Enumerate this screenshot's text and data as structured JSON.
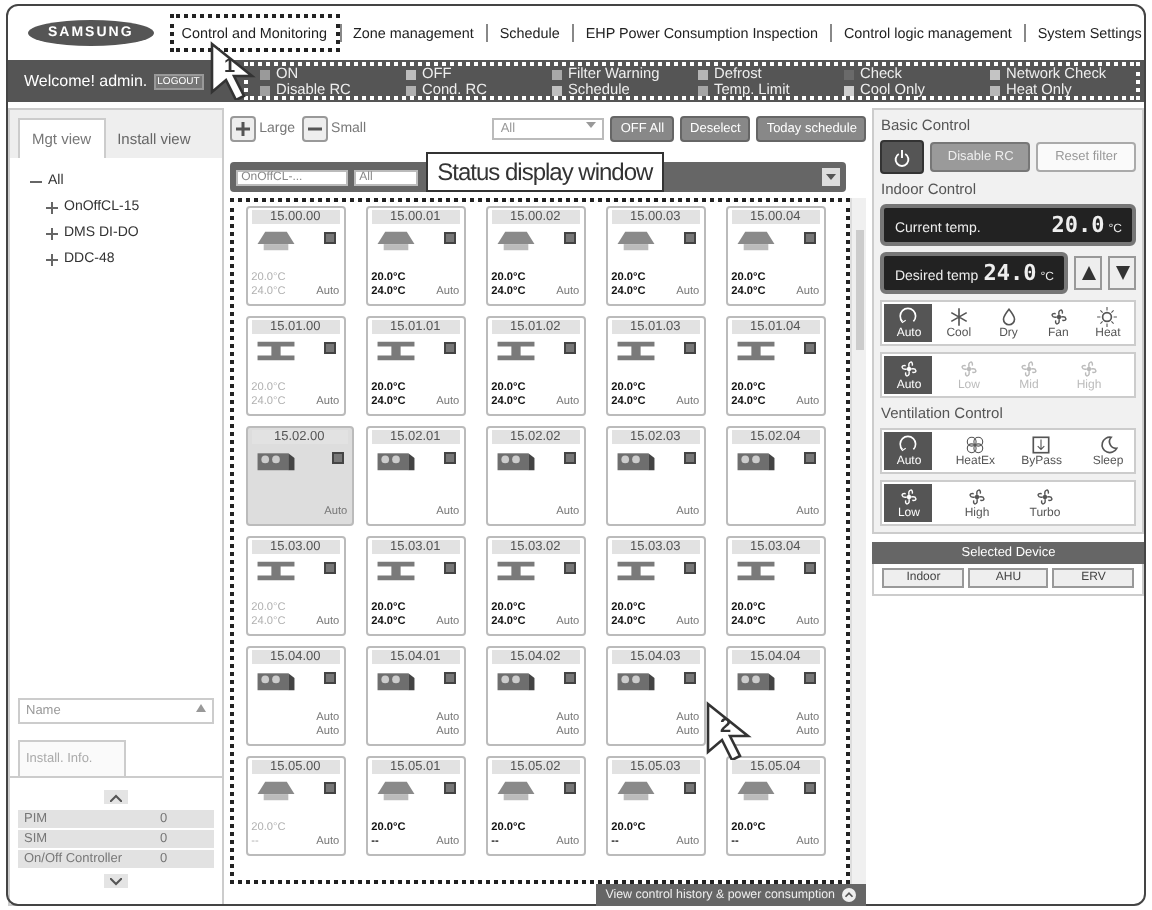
{
  "header": {
    "logo": "SAMSUNG",
    "nav": [
      {
        "label": "Control and Monitoring",
        "selected": true
      },
      {
        "label": "Zone management",
        "selected": false
      },
      {
        "label": "Schedule",
        "selected": false
      },
      {
        "label": "EHP Power Consumption Inspection",
        "selected": false
      },
      {
        "label": "Control logic management",
        "selected": false
      },
      {
        "label": "System Settings",
        "selected": false
      }
    ]
  },
  "status_bar": {
    "welcome": "Welcome! admin.",
    "logout": "LOGOUT",
    "legend": [
      {
        "label": "ON",
        "color": "#9a9a9a"
      },
      {
        "label": "OFF",
        "color": "#bdbdbd"
      },
      {
        "label": "Filter Warning",
        "color": "#a8a8a8"
      },
      {
        "label": "Defrost",
        "color": "#b5b5b5"
      },
      {
        "label": "Check",
        "color": "#6a6a6a"
      },
      {
        "label": "Network Check",
        "color": "#c4c4c4"
      },
      {
        "label": "Disable RC",
        "color": "#a0a0a0"
      },
      {
        "label": "Cond. RC",
        "color": "#b0b0b0"
      },
      {
        "label": "Schedule",
        "color": "#c0c0c0"
      },
      {
        "label": "Temp. Limit",
        "color": "#a5a5a5"
      },
      {
        "label": "Cool Only",
        "color": "#cfcfcf"
      },
      {
        "label": "Heat Only",
        "color": "#b8b8b8"
      }
    ]
  },
  "left_panel": {
    "tabs": [
      {
        "label": "Mgt view",
        "selected": true
      },
      {
        "label": "Install view",
        "selected": false
      }
    ],
    "tree": [
      {
        "label": "All",
        "expanded": true,
        "children": [
          {
            "label": "OnOffCL-15",
            "expanded": false
          },
          {
            "label": "DMS DI-DO",
            "expanded": false
          },
          {
            "label": "DDC-48",
            "expanded": false
          }
        ]
      }
    ],
    "sort_select": "Name",
    "info_tab": "Install. Info.",
    "info_rows": [
      {
        "name": "PIM",
        "count": "0"
      },
      {
        "name": "SIM",
        "count": "0"
      },
      {
        "name": "On/Off Controller",
        "count": "0"
      }
    ]
  },
  "toolbar": {
    "large": "Large",
    "small": "Small",
    "select": "All",
    "buttons": [
      "OFF All",
      "Deselect",
      "Today schedule"
    ]
  },
  "filter": {
    "name": "OnOffCL-...",
    "type": "All"
  },
  "callout": {
    "text": "Status display window"
  },
  "steps": [
    "1",
    "2"
  ],
  "devices": [
    {
      "label": "15.00.00",
      "kind": "cassette",
      "temps": [
        "20.0°C",
        "24.0°C"
      ],
      "modes": [
        "Auto"
      ],
      "dimmed": true,
      "selected": false
    },
    {
      "label": "15.00.01",
      "kind": "cassette",
      "temps": [
        "20.0°C",
        "24.0°C"
      ],
      "modes": [
        "Auto"
      ],
      "dimmed": false,
      "selected": false
    },
    {
      "label": "15.00.02",
      "kind": "cassette",
      "temps": [
        "20.0°C",
        "24.0°C"
      ],
      "modes": [
        "Auto"
      ],
      "dimmed": false,
      "selected": false
    },
    {
      "label": "15.00.03",
      "kind": "cassette",
      "temps": [
        "20.0°C",
        "24.0°C"
      ],
      "modes": [
        "Auto"
      ],
      "dimmed": false,
      "selected": false
    },
    {
      "label": "15.00.04",
      "kind": "cassette",
      "temps": [
        "20.0°C",
        "24.0°C"
      ],
      "modes": [
        "Auto"
      ],
      "dimmed": false,
      "selected": false
    },
    {
      "label": "15.01.00",
      "kind": "duct",
      "temps": [
        "20.0°C",
        "24.0°C"
      ],
      "modes": [
        "Auto"
      ],
      "dimmed": true,
      "selected": false
    },
    {
      "label": "15.01.01",
      "kind": "duct",
      "temps": [
        "20.0°C",
        "24.0°C"
      ],
      "modes": [
        "Auto"
      ],
      "dimmed": false,
      "selected": false
    },
    {
      "label": "15.01.02",
      "kind": "duct",
      "temps": [
        "20.0°C",
        "24.0°C"
      ],
      "modes": [
        "Auto"
      ],
      "dimmed": false,
      "selected": false
    },
    {
      "label": "15.01.03",
      "kind": "duct",
      "temps": [
        "20.0°C",
        "24.0°C"
      ],
      "modes": [
        "Auto"
      ],
      "dimmed": false,
      "selected": false
    },
    {
      "label": "15.01.04",
      "kind": "duct",
      "temps": [
        "20.0°C",
        "24.0°C"
      ],
      "modes": [
        "Auto"
      ],
      "dimmed": false,
      "selected": false
    },
    {
      "label": "15.02.00",
      "kind": "erv",
      "modes": [
        "Auto"
      ],
      "selected": true
    },
    {
      "label": "15.02.01",
      "kind": "erv",
      "modes": [
        "Auto"
      ],
      "selected": false
    },
    {
      "label": "15.02.02",
      "kind": "erv",
      "modes": [
        "Auto"
      ],
      "selected": false
    },
    {
      "label": "15.02.03",
      "kind": "erv",
      "modes": [
        "Auto"
      ],
      "selected": false
    },
    {
      "label": "15.02.04",
      "kind": "erv",
      "modes": [
        "Auto"
      ],
      "selected": false
    },
    {
      "label": "15.03.00",
      "kind": "duct",
      "temps": [
        "20.0°C",
        "24.0°C"
      ],
      "modes": [
        "Auto"
      ],
      "dimmed": true,
      "selected": false
    },
    {
      "label": "15.03.01",
      "kind": "duct",
      "temps": [
        "20.0°C",
        "24.0°C"
      ],
      "modes": [
        "Auto"
      ],
      "dimmed": false,
      "selected": false
    },
    {
      "label": "15.03.02",
      "kind": "duct",
      "temps": [
        "20.0°C",
        "24.0°C"
      ],
      "modes": [
        "Auto"
      ],
      "dimmed": false,
      "selected": false
    },
    {
      "label": "15.03.03",
      "kind": "duct",
      "temps": [
        "20.0°C",
        "24.0°C"
      ],
      "modes": [
        "Auto"
      ],
      "dimmed": false,
      "selected": false
    },
    {
      "label": "15.03.04",
      "kind": "duct",
      "temps": [
        "20.0°C",
        "24.0°C"
      ],
      "modes": [
        "Auto"
      ],
      "dimmed": false,
      "selected": false
    },
    {
      "label": "15.04.00",
      "kind": "erv",
      "modes": [
        "Auto",
        "Auto"
      ],
      "selected": false
    },
    {
      "label": "15.04.01",
      "kind": "erv",
      "modes": [
        "Auto",
        "Auto"
      ],
      "selected": false
    },
    {
      "label": "15.04.02",
      "kind": "erv",
      "modes": [
        "Auto",
        "Auto"
      ],
      "selected": false
    },
    {
      "label": "15.04.03",
      "kind": "erv",
      "modes": [
        "Auto",
        "Auto"
      ],
      "selected": false
    },
    {
      "label": "15.04.04",
      "kind": "erv",
      "modes": [
        "Auto",
        "Auto"
      ],
      "selected": false
    },
    {
      "label": "15.05.00",
      "kind": "cassette",
      "temps": [
        "20.0°C",
        "--"
      ],
      "modes": [
        "Auto"
      ],
      "dimmed": true,
      "selected": false
    },
    {
      "label": "15.05.01",
      "kind": "cassette",
      "temps": [
        "20.0°C",
        "--"
      ],
      "modes": [
        "Auto"
      ],
      "dimmed": false,
      "selected": false
    },
    {
      "label": "15.05.02",
      "kind": "cassette",
      "temps": [
        "20.0°C",
        "--"
      ],
      "modes": [
        "Auto"
      ],
      "dimmed": false,
      "selected": false
    },
    {
      "label": "15.05.03",
      "kind": "cassette",
      "temps": [
        "20.0°C",
        "--"
      ],
      "modes": [
        "Auto"
      ],
      "dimmed": false,
      "selected": false
    },
    {
      "label": "15.05.04",
      "kind": "cassette",
      "temps": [
        "20.0°C",
        "--"
      ],
      "modes": [
        "Auto"
      ],
      "dimmed": false,
      "selected": false
    }
  ],
  "history_button": "View control history & power consumption",
  "right_panel": {
    "basic_title": "Basic Control",
    "disable_rc": "Disable RC",
    "reset_filter": "Reset filter",
    "indoor_title": "Indoor Control",
    "current_label": "Current temp.",
    "current_value": "20.0",
    "current_unit": "°C",
    "desired_label": "Desired temp",
    "desired_value": "24.0",
    "desired_unit": "°C",
    "modes": [
      {
        "label": "Auto",
        "kind": "auto",
        "selected": true,
        "disabled": false
      },
      {
        "label": "Cool",
        "kind": "cool",
        "selected": false,
        "disabled": false
      },
      {
        "label": "Dry",
        "kind": "dry",
        "selected": false,
        "disabled": false
      },
      {
        "label": "Fan",
        "kind": "fan",
        "selected": false,
        "disabled": false
      },
      {
        "label": "Heat",
        "kind": "heat",
        "selected": false,
        "disabled": false
      }
    ],
    "fan_speeds": [
      {
        "label": "Auto",
        "kind": "fan",
        "selected": true,
        "disabled": false
      },
      {
        "label": "Low",
        "kind": "fan",
        "selected": false,
        "disabled": true
      },
      {
        "label": "Mid",
        "kind": "fan",
        "selected": false,
        "disabled": true
      },
      {
        "label": "High",
        "kind": "fan",
        "selected": false,
        "disabled": true
      }
    ],
    "vent_title": "Ventilation Control",
    "vent_modes": [
      {
        "label": "Auto",
        "kind": "auto",
        "selected": true,
        "disabled": false
      },
      {
        "label": "HeatEx",
        "kind": "heatex",
        "selected": false,
        "disabled": false
      },
      {
        "label": "ByPass",
        "kind": "bypass",
        "selected": false,
        "disabled": false
      },
      {
        "label": "Sleep",
        "kind": "sleep",
        "selected": false,
        "disabled": false
      }
    ],
    "vent_speeds": [
      {
        "label": "Low",
        "kind": "fan",
        "selected": true,
        "disabled": false
      },
      {
        "label": "High",
        "kind": "fan",
        "selected": false,
        "disabled": false
      },
      {
        "label": "Turbo",
        "kind": "fan",
        "selected": false,
        "disabled": false
      }
    ],
    "device_title": "Selected Device",
    "device_buttons": [
      "Indoor",
      "AHU",
      "ERV"
    ]
  }
}
